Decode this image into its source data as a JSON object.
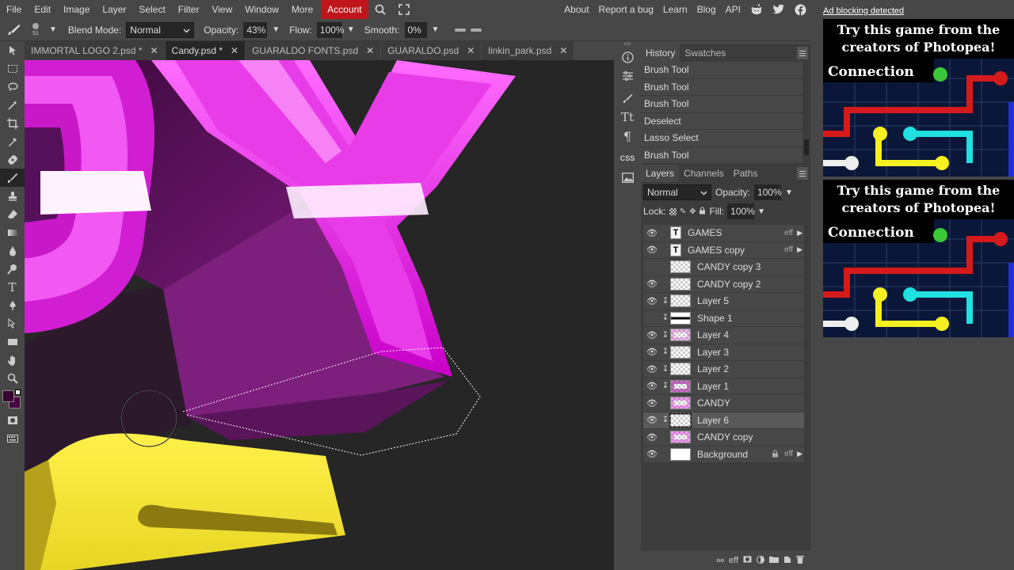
{
  "menubar": {
    "items": [
      "File",
      "Edit",
      "Image",
      "Layer",
      "Select",
      "Filter",
      "View",
      "Window",
      "More"
    ],
    "account": "Account",
    "right_links": [
      "About",
      "Report a bug",
      "Learn",
      "Blog",
      "API"
    ]
  },
  "options": {
    "blend_mode_label": "Blend Mode:",
    "blend_mode_value": "Normal",
    "opacity_label": "Opacity:",
    "opacity_value": "43%",
    "flow_label": "Flow:",
    "flow_value": "100%",
    "smooth_label": "Smooth:",
    "smooth_value": "0%",
    "brush_size": "51"
  },
  "tabs": [
    {
      "label": "IMMORTAL LOGO 2.psd *",
      "active": false
    },
    {
      "label": "Candy.psd *",
      "active": true
    },
    {
      "label": "GUARALDO FONTS.psd",
      "active": false
    },
    {
      "label": "GUARALDO.psd",
      "active": false
    },
    {
      "label": "linkin_park.psd",
      "active": false
    }
  ],
  "history_panel": {
    "tabs": [
      "History",
      "Swatches"
    ],
    "items": [
      "Brush Tool",
      "Brush Tool",
      "Brush Tool",
      "Deselect",
      "Lasso Select",
      "Brush Tool"
    ]
  },
  "layers_panel": {
    "tabs": [
      "Layers",
      "Channels",
      "Paths"
    ],
    "blend": "Normal",
    "opacity_label": "Opacity:",
    "opacity_value": "100%",
    "lock_label": "Lock:",
    "fill_label": "Fill:",
    "fill_value": "100%",
    "layers": [
      {
        "name": "GAMES",
        "type": "text",
        "visible": true,
        "eff": "eff"
      },
      {
        "name": "GAMES copy",
        "type": "text",
        "visible": true,
        "eff": "eff"
      },
      {
        "name": "CANDY copy 3",
        "type": "raster",
        "visible": false
      },
      {
        "name": "CANDY copy 2",
        "type": "raster",
        "visible": true
      },
      {
        "name": "Layer 5",
        "type": "raster",
        "visible": true,
        "clipped": true
      },
      {
        "name": "Shape 1",
        "type": "raster",
        "visible": false,
        "clipped": true
      },
      {
        "name": "Layer 4",
        "type": "raster",
        "visible": true,
        "clipped": true
      },
      {
        "name": "Layer 3",
        "type": "raster",
        "visible": true,
        "clipped": true
      },
      {
        "name": "Layer 2",
        "type": "raster",
        "visible": true,
        "clipped": true
      },
      {
        "name": "Layer 1",
        "type": "raster",
        "visible": true,
        "clipped": true
      },
      {
        "name": "CANDY",
        "type": "raster",
        "visible": true
      },
      {
        "name": "Layer 6",
        "type": "raster",
        "visible": true,
        "clipped": true,
        "selected": true
      },
      {
        "name": "CANDY copy",
        "type": "raster",
        "visible": true
      },
      {
        "name": "Background",
        "type": "background",
        "visible": true,
        "locked": true,
        "eff": "eff"
      }
    ],
    "bottom_icons": [
      "link-icon",
      "effects-icon",
      "mask-icon",
      "adjustment-icon",
      "folder-icon",
      "new-layer-icon",
      "trash-icon"
    ],
    "bottom_eff": "eff"
  },
  "ad": {
    "notice": "Ad blocking detected",
    "headline": "Try this game from the creators of Photopea!",
    "game_title": "Connection"
  },
  "colors": {
    "account_bg": "#c0161b",
    "candy_pink": "#e020e0",
    "candy_yellow": "#f5e53a",
    "canvas_bg": "#262626"
  }
}
